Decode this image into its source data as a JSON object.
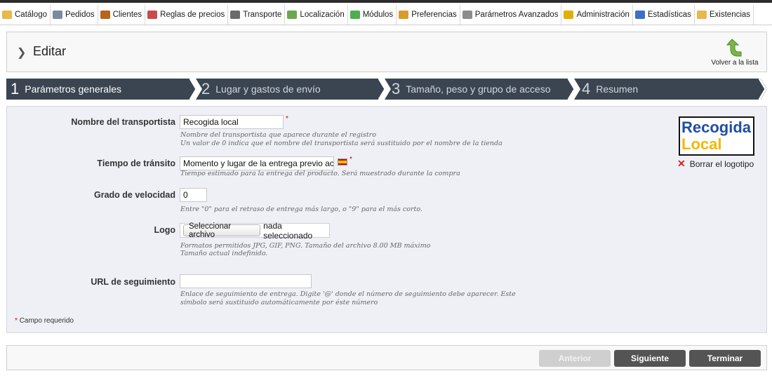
{
  "menu": [
    {
      "label": "Catálogo",
      "icon": "folder-icon",
      "color": "#e8b84a"
    },
    {
      "label": "Pedidos",
      "icon": "cart-icon",
      "color": "#7a8aa0"
    },
    {
      "label": "Clientes",
      "icon": "user-icon",
      "color": "#b5651d"
    },
    {
      "label": "Reglas de precios",
      "icon": "price-rules-icon",
      "color": "#c94b4b"
    },
    {
      "label": "Transporte",
      "icon": "truck-icon",
      "color": "#6b6b6b"
    },
    {
      "label": "Localización",
      "icon": "globe-icon",
      "color": "#6aa84f"
    },
    {
      "label": "Módulos",
      "icon": "puzzle-icon",
      "color": "#4caf50"
    },
    {
      "label": "Preferencias",
      "icon": "preferences-icon",
      "color": "#d89b2b"
    },
    {
      "label": "Parámetros Avanzados",
      "icon": "wrench-icon",
      "color": "#8c8c8c"
    },
    {
      "label": "Administración",
      "icon": "key-icon",
      "color": "#e0b000"
    },
    {
      "label": "Estadísticas",
      "icon": "stats-icon",
      "color": "#3d6fc4"
    },
    {
      "label": "Existencias",
      "icon": "stock-icon",
      "color": "#e8b84a"
    }
  ],
  "header": {
    "title": "Editar",
    "back_label": "Volver a la lista"
  },
  "steps": [
    {
      "num": "1",
      "label": "Parámetros generales"
    },
    {
      "num": "2",
      "label": "Lugar y gastos de envío"
    },
    {
      "num": "3",
      "label": "Tamaño, peso y grupo de acceso"
    },
    {
      "num": "4",
      "label": "Resumen"
    }
  ],
  "form": {
    "name_label": "Nombre del transportista",
    "name_value": "Recogida local",
    "name_hint_1": "Nombre del transportista que aparece durante el registro",
    "name_hint_2": "Un valor de 0 indica que el nombre del transportista será sustituido por el nombre de la tienda",
    "transit_label": "Tiempo de tránsito",
    "transit_value": "Momento y lugar de la entrega previo acuerdo",
    "transit_hint": "Tiempo estimado para la entrega del producto. Será muestrado durante la compra",
    "speed_label": "Grado de velocidad",
    "speed_value": "0",
    "speed_hint": "Entre \"0\" para el retraso de entrega más largo, o \"9\" para el más corto.",
    "logo_label": "Logo",
    "file_button": "Seleccionar archivo",
    "file_status": "nada seleccionado",
    "logo_hint_1": "Formatos permitidos JPG, GIF, PNG. Tamaño del archivo 8.00 MB máximo",
    "logo_hint_2": "Tamaño actual indefinido.",
    "url_label": "URL de seguimiento",
    "url_value": "",
    "url_hint_1": "Enlace de seguimiento de entrega. Digite '@' donde el número de seguimiento debe aparecer. Este",
    "url_hint_2": "símbolo será sustituido automáticamente por éste número",
    "required_star": "*",
    "required_note": "Campo requerido"
  },
  "logo_preview": {
    "line1": "Recogida",
    "line2": "Local",
    "delete_label": "Borrar el logotipo"
  },
  "footer": {
    "prev": "Anterior",
    "next": "Siguiente",
    "finish": "Terminar"
  },
  "colors": {
    "step_bg": "#3b4551",
    "form_bg": "#eef0f5",
    "button_dark": "#545454",
    "required": "#cc0000"
  }
}
